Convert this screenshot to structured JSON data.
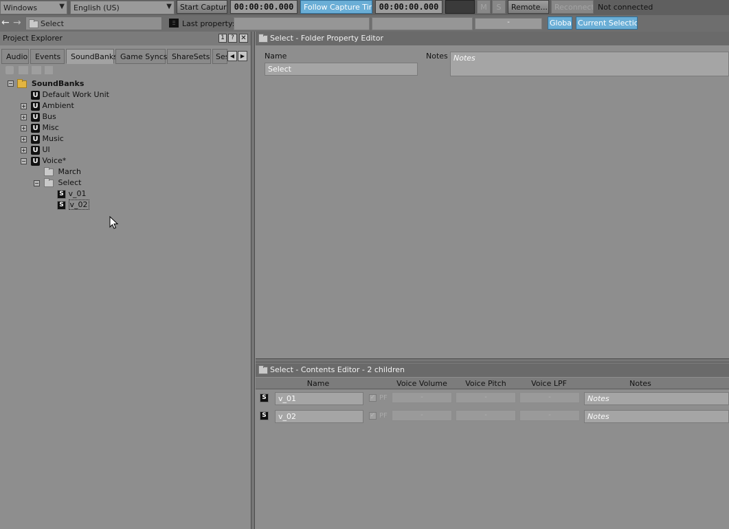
{
  "toolbar1": {
    "platform": "Windows",
    "language": "English (US)",
    "start_capture": "Start Capture",
    "time1": "00:00:00.000",
    "follow_capture": "Follow Capture Time",
    "time2": "00:00:00.000",
    "m_label": "M",
    "s_label": "S",
    "remote": "Remote...",
    "reconnect": "Reconnect",
    "status": "Not connected"
  },
  "toolbar2": {
    "selected_object": "Select",
    "last_property_label": "Last property:",
    "dash": "-",
    "global": "Global",
    "current_selection": "Current Selection"
  },
  "explorer": {
    "title": "Project Explorer",
    "pin": "1",
    "help": "?",
    "tabs": [
      "Audio",
      "Events",
      "SoundBanks",
      "Game Syncs",
      "ShareSets",
      "Ses"
    ],
    "active_tab": "SoundBanks",
    "tree": {
      "root": "SoundBanks",
      "items": [
        "Default Work Unit",
        "Ambient",
        "Bus",
        "Misc",
        "Music",
        "UI",
        "Voice*"
      ],
      "voice_children": [
        "March",
        "Select"
      ],
      "select_children": [
        "v_01",
        "v_02"
      ]
    }
  },
  "property_editor": {
    "title": "Select - Folder Property Editor",
    "name_label": "Name",
    "name_value": "Select",
    "notes_label": "Notes",
    "notes_placeholder": "Notes"
  },
  "contents_editor": {
    "title": "Select - Contents Editor - 2 children",
    "columns": [
      "Name",
      "Voice Volume",
      "Voice Pitch",
      "Voice LPF",
      "Notes"
    ],
    "rows": [
      {
        "icon": "S",
        "name": "v_01",
        "pf": "PF",
        "volume": "-",
        "pitch": "-",
        "lpf": "-",
        "notes": "Notes"
      },
      {
        "icon": "S",
        "name": "v_02",
        "pf": "PF",
        "volume": "-",
        "pitch": "-",
        "lpf": "-",
        "notes": "Notes"
      }
    ]
  }
}
